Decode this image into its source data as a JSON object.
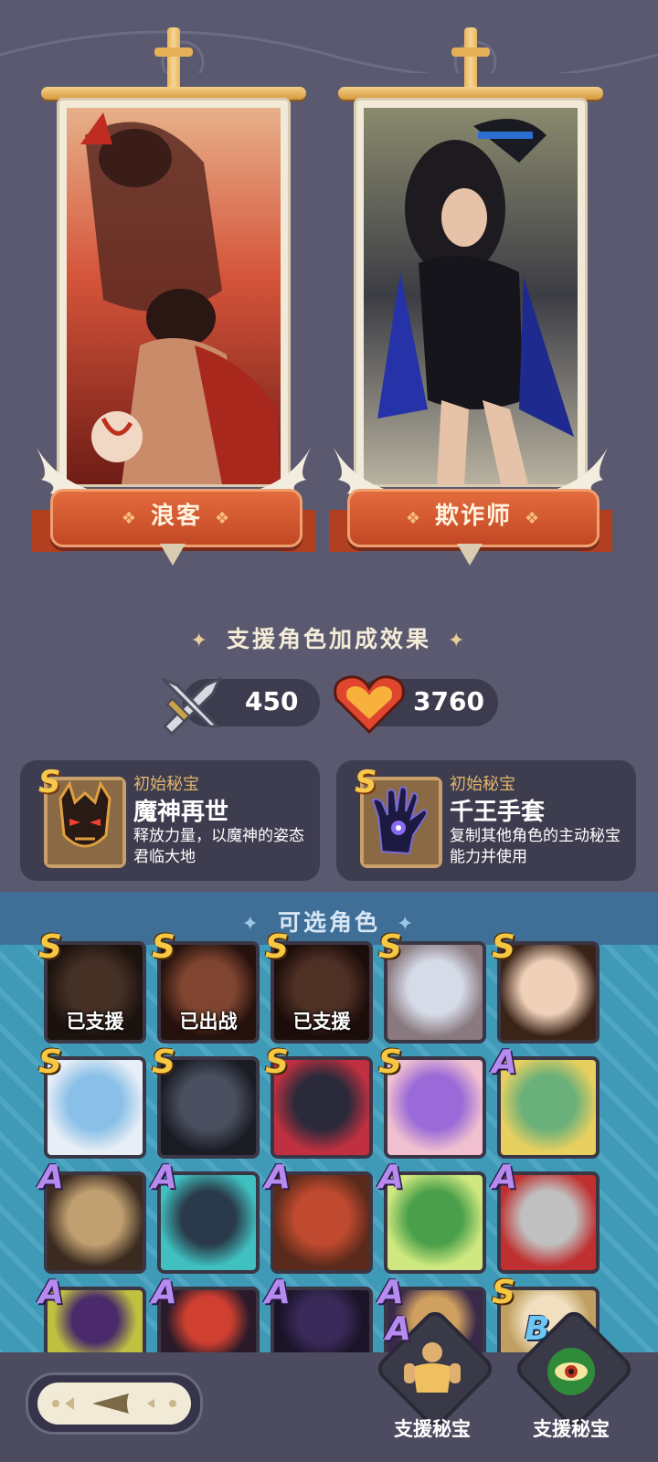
{
  "banners": [
    {
      "name": "浪客"
    },
    {
      "name": "欺诈师"
    }
  ],
  "support_bonus": {
    "title": "支援角色加成效果",
    "attack": "450",
    "hp": "3760"
  },
  "treasures": [
    {
      "rank": "S",
      "label": "初始秘宝",
      "name": "魔神再世",
      "desc": "释放力量，以魔神的姿态君临大地"
    },
    {
      "rank": "S",
      "label": "初始秘宝",
      "name": "千王手套",
      "desc": "复制其他角色的主动秘宝能力并使用"
    }
  ],
  "available": {
    "title": "可选角色",
    "cards": [
      {
        "rank": "S",
        "status": "已支援"
      },
      {
        "rank": "S",
        "status": "已出战"
      },
      {
        "rank": "S",
        "status": "已支援"
      },
      {
        "rank": "S",
        "status": ""
      },
      {
        "rank": "S",
        "status": ""
      },
      {
        "rank": "S",
        "status": ""
      },
      {
        "rank": "S",
        "status": ""
      },
      {
        "rank": "S",
        "status": ""
      },
      {
        "rank": "S",
        "status": ""
      },
      {
        "rank": "A",
        "status": ""
      },
      {
        "rank": "A",
        "status": ""
      },
      {
        "rank": "A",
        "status": ""
      },
      {
        "rank": "A",
        "status": ""
      },
      {
        "rank": "A",
        "status": ""
      },
      {
        "rank": "A",
        "status": ""
      },
      {
        "rank": "A",
        "status": ""
      },
      {
        "rank": "A",
        "status": ""
      },
      {
        "rank": "A",
        "status": ""
      },
      {
        "rank": "A",
        "status": ""
      },
      {
        "rank": "S",
        "status": ""
      }
    ]
  },
  "bottom": {
    "support_treasure_1": {
      "rank": "A",
      "label": "支援秘宝"
    },
    "support_treasure_2": {
      "rank": "B",
      "label": "支援秘宝"
    }
  },
  "icons": {
    "attack": "sword-icon",
    "hp": "heart-icon",
    "back": "back-arrow-icon"
  },
  "colors": {
    "background": "#5a596f",
    "ribbon": "#d2552c",
    "grid_bg": "#3f9ab8",
    "rank_S": "#f6c743",
    "rank_A": "#b58bf0",
    "rank_B": "#6fc6f2"
  }
}
